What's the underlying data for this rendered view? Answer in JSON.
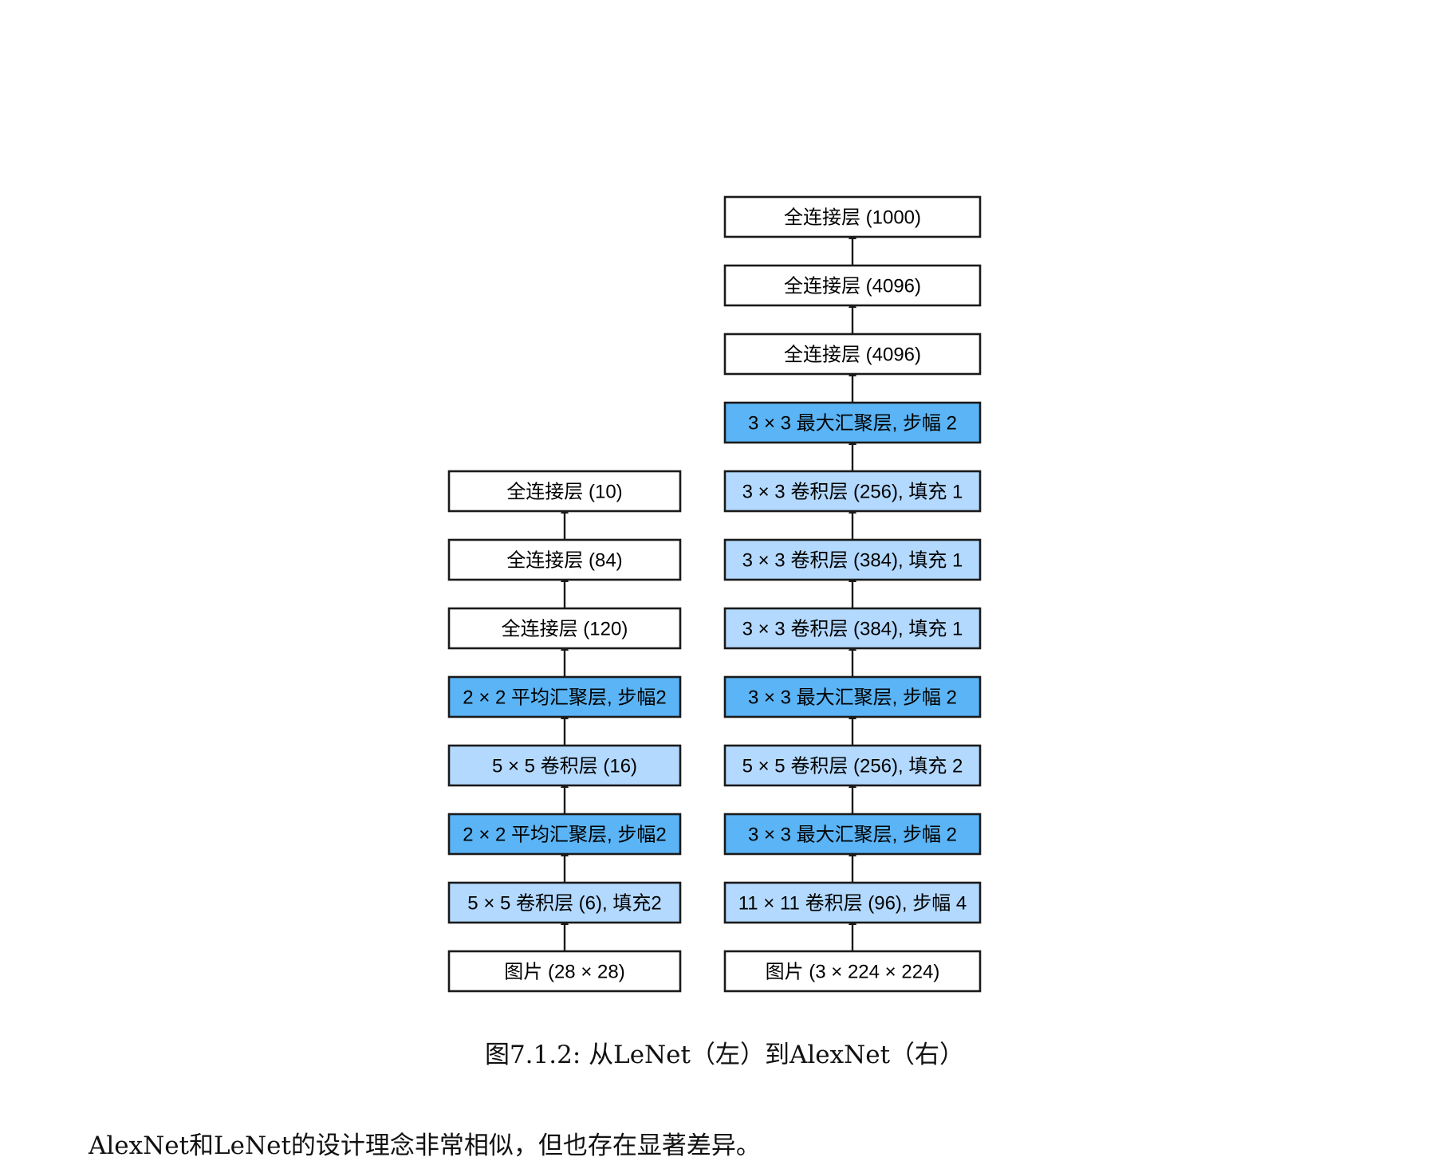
{
  "colors": {
    "fc": "#ffffff",
    "conv": "#b3d9ff",
    "pool": "#5ab4f5"
  },
  "lenet": {
    "layers": [
      {
        "label": "图片 (28 × 28)",
        "kind": "fc"
      },
      {
        "label": "5 × 5 卷积层 (6), 填充2",
        "kind": "conv"
      },
      {
        "label": "2 × 2 平均汇聚层, 步幅2",
        "kind": "pool"
      },
      {
        "label": "5 × 5 卷积层 (16)",
        "kind": "conv"
      },
      {
        "label": "2 × 2 平均汇聚层, 步幅2",
        "kind": "pool"
      },
      {
        "label": "全连接层 (120)",
        "kind": "fc"
      },
      {
        "label": "全连接层 (84)",
        "kind": "fc"
      },
      {
        "label": "全连接层 (10)",
        "kind": "fc"
      }
    ]
  },
  "alexnet": {
    "layers": [
      {
        "label": "图片 (3 × 224 × 224)",
        "kind": "fc"
      },
      {
        "label": "11 × 11 卷积层 (96), 步幅 4",
        "kind": "conv"
      },
      {
        "label": "3 × 3 最大汇聚层, 步幅 2",
        "kind": "pool"
      },
      {
        "label": "5 × 5 卷积层 (256), 填充 2",
        "kind": "conv"
      },
      {
        "label": "3 × 3 最大汇聚层, 步幅 2",
        "kind": "pool"
      },
      {
        "label": "3 × 3 卷积层 (384), 填充 1",
        "kind": "conv"
      },
      {
        "label": "3 × 3 卷积层 (384), 填充 1",
        "kind": "conv"
      },
      {
        "label": "3 × 3 卷积层 (256), 填充 1",
        "kind": "conv"
      },
      {
        "label": "3 × 3 最大汇聚层, 步幅 2",
        "kind": "pool"
      },
      {
        "label": "全连接层 (4096)",
        "kind": "fc"
      },
      {
        "label": "全连接层 (4096)",
        "kind": "fc"
      },
      {
        "label": "全连接层 (1000)",
        "kind": "fc"
      }
    ]
  },
  "caption": "图7.1.2: 从LeNet（左）到AlexNet（右）",
  "body_text": "AlexNet和LeNet的设计理念非常相似，但也存在显著差异。"
}
